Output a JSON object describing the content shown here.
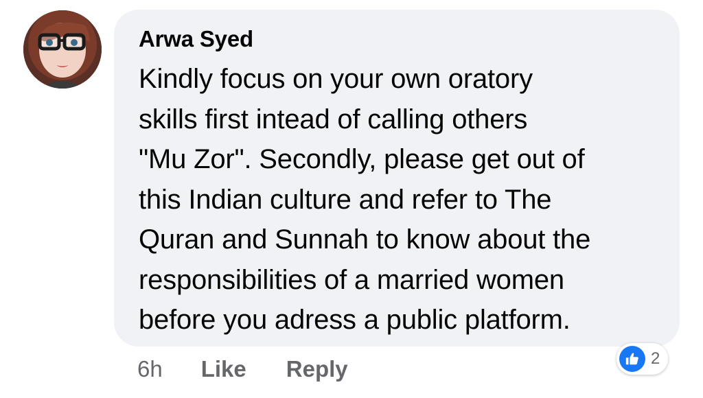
{
  "comment": {
    "author": "Arwa Syed",
    "text": "Kindly focus on your own oratory\nskills first intead of calling others\n\"Mu Zor\". Secondly, please get out of\nthis Indian culture and refer to The\nQuran and Sunnah to know about the\nresponsibilities of a married women\nbefore you adress a public platform.",
    "timestamp": "6h",
    "like_label": "Like",
    "reply_label": "Reply",
    "reaction_icon": "thumbs-up-icon",
    "reaction_count": "2"
  },
  "colors": {
    "bubble_bg": "#f0f2f5",
    "text": "#050505",
    "secondary_text": "#65676b",
    "like_blue": "#1877f2"
  }
}
